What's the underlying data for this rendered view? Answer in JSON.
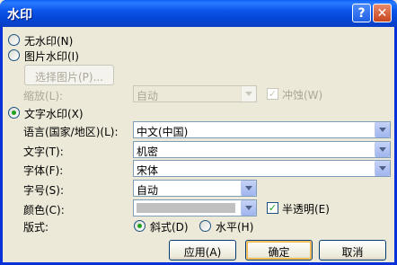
{
  "dialog": {
    "title": "水印",
    "help_glyph": "?",
    "close_glyph": "✕"
  },
  "options": {
    "no_watermark": "无水印(N)",
    "picture_watermark": "图片水印(I)",
    "select_picture": "选择图片(P)...",
    "scale_label": "缩放(L):",
    "scale_value": "自动",
    "washout_label": "冲蚀(W)",
    "washout_checked": true,
    "text_watermark": "文字水印(X)",
    "selected": "text"
  },
  "text_fields": {
    "language_label": "语言(国家/地区)(L):",
    "language_value": "中文(中国)",
    "text_label": "文字(T):",
    "text_value": "机密",
    "font_label": "字体(F):",
    "font_value": "宋体",
    "size_label": "字号(S):",
    "size_value": "自动",
    "color_label": "颜色(C):",
    "color_value": "#c0c0c0",
    "semitransparent_label": "半透明(E)",
    "semitransparent_checked": true,
    "layout_label": "版式:",
    "diagonal_label": "斜式(D)",
    "horizontal_label": "水平(H)",
    "layout_selected": "diagonal"
  },
  "buttons": {
    "apply": "应用(A)",
    "ok": "确定",
    "cancel": "取消"
  },
  "check_glyph": "✓"
}
